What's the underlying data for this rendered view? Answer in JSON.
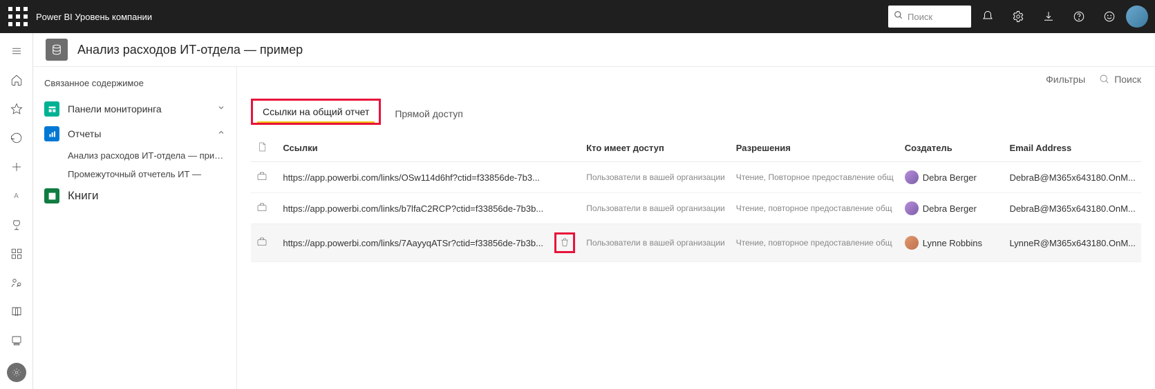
{
  "topbar": {
    "brand": "Power BI Уровень компании",
    "search_placeholder": "Поиск"
  },
  "workspace": {
    "title": "Анализ расходов ИТ-отдела — пример"
  },
  "sidepanel": {
    "title": "Связанное содержимое",
    "dashboards_label": "Панели мониторинга",
    "reports_label": "Отчеты",
    "report_child_1": "Анализ расходов ИТ-отдела — пример",
    "report_child_2": "Промежуточный отчетель ИТ —",
    "workbooks_label": "Книги"
  },
  "main_toolbar": {
    "filters": "Фильтры",
    "search": "Поиск"
  },
  "tabs": {
    "shared_links": "Ссылки на общий отчет",
    "direct_access": "Прямой доступ"
  },
  "table": {
    "headers": {
      "links": "Ссылки",
      "who": "Кто имеет доступ",
      "permissions": "Разрешения",
      "creator": "Создатель",
      "email": "Email Address"
    },
    "rows": [
      {
        "link": "https://app.powerbi.com/links/OSw114d6hf?ctid=f33856de-7b3...",
        "who": "Пользователи в вашей организации",
        "perm": "Чтение, Повторное предоставление общ",
        "creator": "Debra Berger",
        "email": "DebraB@M365x643180.OnM..."
      },
      {
        "link": "https://app.powerbi.com/links/b7lfaC2RCP?ctid=f33856de-7b3b...",
        "who": "Пользователи в вашей организации",
        "perm": "Чтение, повторное предоставление общ",
        "creator": "Debra Berger",
        "email": "DebraB@M365x643180.OnM..."
      },
      {
        "link": "https://app.powerbi.com/links/7AayyqATSr?ctid=f33856de-7b3b...",
        "who": "Пользователи в вашей организации",
        "perm": "Чтение, повторное предоставление общ",
        "creator": "Lynne Robbins",
        "email": "LynneR@M365x643180.OnM..."
      }
    ]
  }
}
